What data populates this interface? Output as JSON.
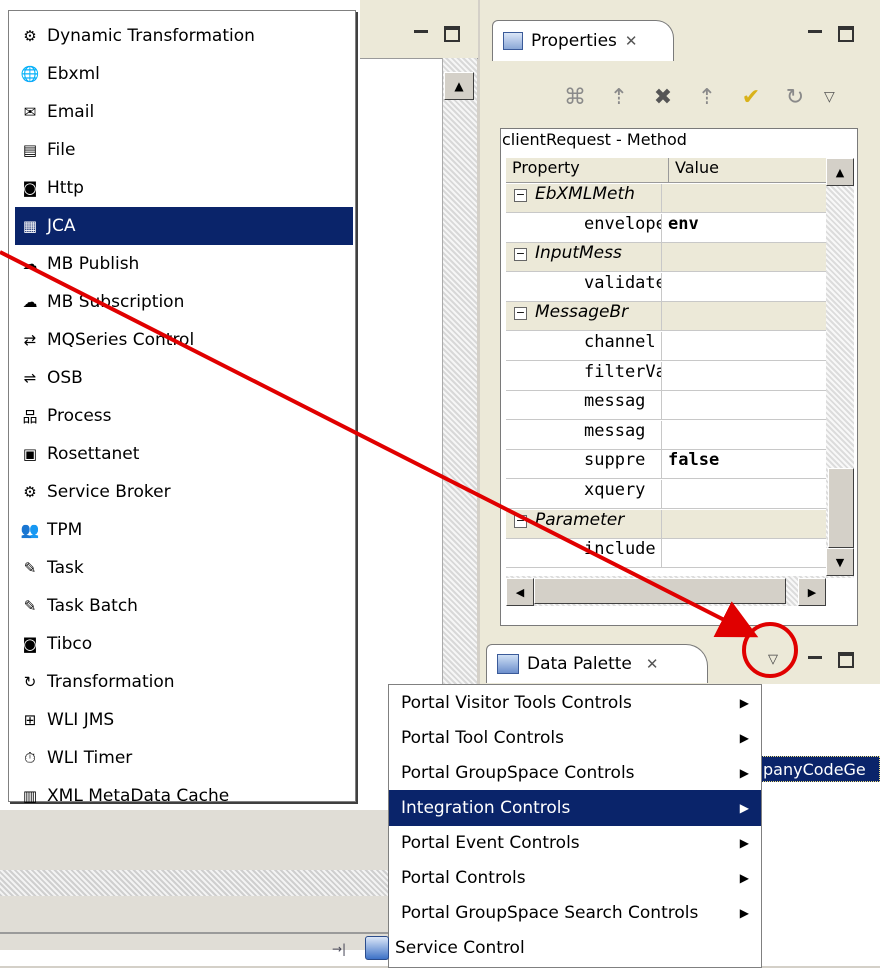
{
  "integration_menu": {
    "items": [
      {
        "label": "Dynamic Transformation",
        "icon": "dynamic-transformation-icon",
        "glyph": "⚙"
      },
      {
        "label": "Ebxml",
        "icon": "ebxml-icon",
        "glyph": "🌐"
      },
      {
        "label": "Email",
        "icon": "email-icon",
        "glyph": "✉"
      },
      {
        "label": "File",
        "icon": "file-icon",
        "glyph": "▤"
      },
      {
        "label": "Http",
        "icon": "http-icon",
        "glyph": "◙"
      },
      {
        "label": "JCA",
        "icon": "jca-icon",
        "glyph": "▦",
        "selected": true
      },
      {
        "label": "MB Publish",
        "icon": "mb-publish-icon",
        "glyph": "☁"
      },
      {
        "label": "MB Subscription",
        "icon": "mb-subscription-icon",
        "glyph": "☁"
      },
      {
        "label": "MQSeries Control",
        "icon": "mqseries-icon",
        "glyph": "⇄"
      },
      {
        "label": "OSB",
        "icon": "osb-icon",
        "glyph": "⇌"
      },
      {
        "label": "Process",
        "icon": "process-icon",
        "glyph": "品"
      },
      {
        "label": "Rosettanet",
        "icon": "rosettanet-icon",
        "glyph": "▣"
      },
      {
        "label": "Service Broker",
        "icon": "service-broker-icon",
        "glyph": "⚙"
      },
      {
        "label": "TPM",
        "icon": "tpm-icon",
        "glyph": "👥"
      },
      {
        "label": "Task",
        "icon": "task-icon",
        "glyph": "✎"
      },
      {
        "label": "Task Batch",
        "icon": "task-batch-icon",
        "glyph": "✎"
      },
      {
        "label": "Tibco",
        "icon": "tibco-icon",
        "glyph": "◙"
      },
      {
        "label": "Transformation",
        "icon": "transformation-icon",
        "glyph": "↻"
      },
      {
        "label": "WLI JMS",
        "icon": "wli-jms-icon",
        "glyph": "⊞"
      },
      {
        "label": "WLI Timer",
        "icon": "wli-timer-icon",
        "glyph": "⏱"
      },
      {
        "label": "XML MetaData Cache",
        "icon": "xml-metadata-cache-icon",
        "glyph": "▥"
      }
    ]
  },
  "properties_view": {
    "tab_label": "Properties",
    "close_glyph": "✕",
    "caption": "clientRequest - Method",
    "columns": {
      "property": "Property",
      "value": "Value"
    },
    "rows": [
      {
        "type": "group",
        "name": "EbXMLMeth",
        "value": ""
      },
      {
        "type": "leaf",
        "name": "envelope",
        "value": "env"
      },
      {
        "type": "group",
        "name": "InputMess",
        "value": ""
      },
      {
        "type": "leaf",
        "name": "validate",
        "value": ""
      },
      {
        "type": "group",
        "name": "MessageBr",
        "value": ""
      },
      {
        "type": "leaf",
        "name": "channel",
        "value": ""
      },
      {
        "type": "leaf",
        "name": "filterVa",
        "value": ""
      },
      {
        "type": "leaf",
        "name": "messag",
        "value": ""
      },
      {
        "type": "leaf",
        "name": "messag",
        "value": ""
      },
      {
        "type": "leaf",
        "name": "suppre",
        "value": "false"
      },
      {
        "type": "leaf",
        "name": "xquery",
        "value": ""
      },
      {
        "type": "group",
        "name": "Parameter",
        "value": ""
      },
      {
        "type": "leaf",
        "name": "include",
        "value": ""
      }
    ]
  },
  "data_palette": {
    "tab_label": "Data Palette",
    "close_glyph": "✕",
    "visible_item": "panyCodeGe"
  },
  "context_menu": {
    "items": [
      {
        "label": "Portal Visitor Tools Controls",
        "submenu": true
      },
      {
        "label": "Portal Tool Controls",
        "submenu": true
      },
      {
        "label": "Portal GroupSpace Controls",
        "submenu": true
      },
      {
        "label": "Integration Controls",
        "submenu": true,
        "selected": true
      },
      {
        "label": "Portal Event Controls",
        "submenu": true
      },
      {
        "label": "Portal Controls",
        "submenu": true
      },
      {
        "label": "Portal GroupSpace Search Controls",
        "submenu": true
      },
      {
        "label": "Service Control",
        "submenu": false,
        "icon": "service-control-icon"
      }
    ]
  },
  "colors": {
    "selection": "#0a246a",
    "annotation": "#e00000"
  }
}
